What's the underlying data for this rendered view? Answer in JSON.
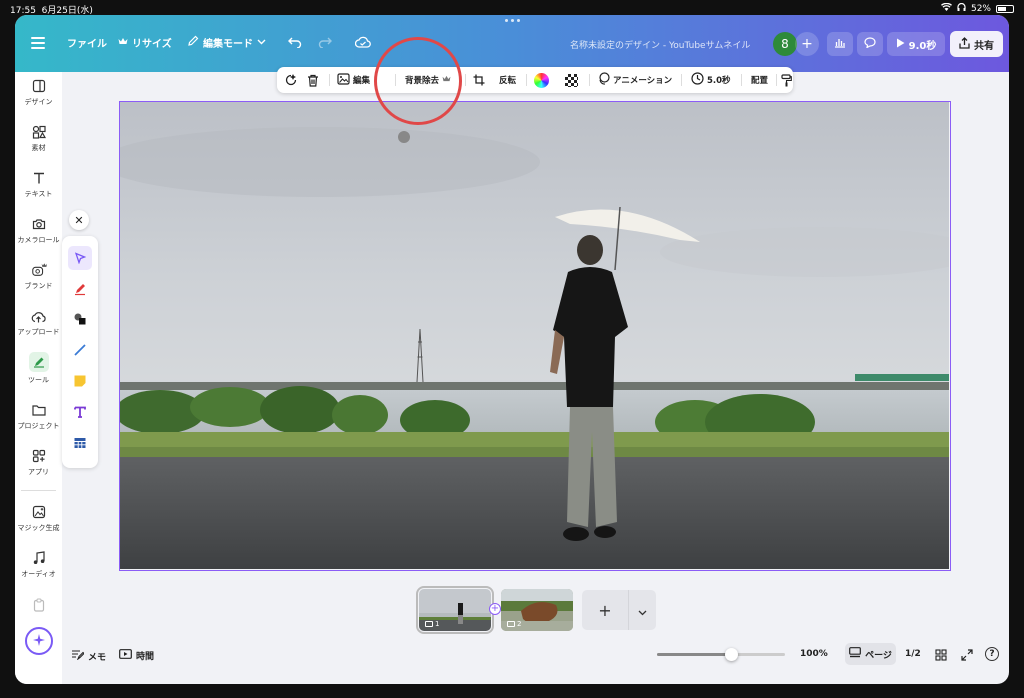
{
  "status_bar": {
    "time": "17:55",
    "date": "6月25日(水)",
    "battery": "52%"
  },
  "header": {
    "file": "ファイル",
    "resize": "リサイズ",
    "edit_mode": "編集モード",
    "doc_title": "名称未設定のデザイン - YouTubeサムネイル",
    "avatar_initial": "8",
    "play_duration": "9.0秒",
    "share": "共有"
  },
  "sidebar": {
    "items": [
      {
        "label": "デザイン",
        "icon": "design-icon"
      },
      {
        "label": "素材",
        "icon": "elements-icon"
      },
      {
        "label": "テキスト",
        "icon": "text-icon"
      },
      {
        "label": "カメラロール",
        "icon": "camera-icon"
      },
      {
        "label": "ブランド",
        "icon": "brand-icon"
      },
      {
        "label": "アップロード",
        "icon": "upload-icon"
      },
      {
        "label": "ツール",
        "icon": "tools-icon"
      },
      {
        "label": "プロジェクト",
        "icon": "folder-icon"
      },
      {
        "label": "アプリ",
        "icon": "apps-icon"
      },
      {
        "label": "マジック生成",
        "icon": "magic-media-icon"
      },
      {
        "label": "オーディオ",
        "icon": "music-icon"
      }
    ]
  },
  "context_toolbar": {
    "edit": "編集",
    "bg_remove": "背景除去",
    "flip": "反転",
    "animation": "アニメーション",
    "duration": "5.0秒",
    "position": "配置"
  },
  "pages": {
    "thumb1_num": "1",
    "thumb2_num": "2"
  },
  "bottom_bar": {
    "notes": "メモ",
    "timer": "時間",
    "zoom_percent": "100%",
    "zoom_level": 0.58,
    "pages_label": "ページ",
    "page_count": "1/2",
    "help": "?"
  },
  "colors": {
    "accent": "#8b5cf6",
    "annotation": "#e04848",
    "avatar": "#2e8a3a"
  }
}
